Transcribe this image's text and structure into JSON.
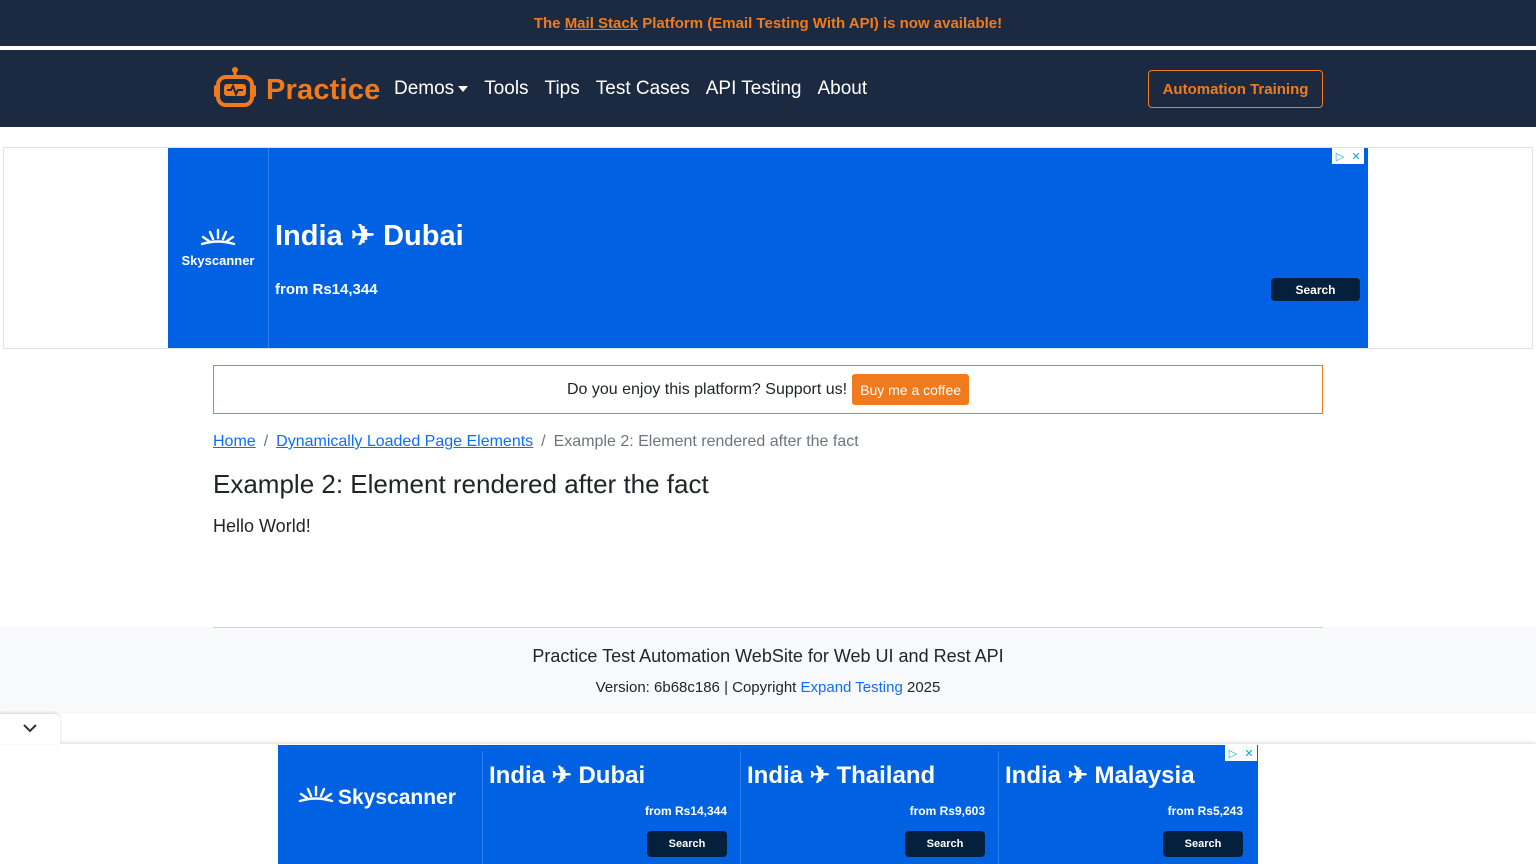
{
  "announcement": {
    "prefix": "The ",
    "link": "Mail Stack",
    "suffix": " Platform (Email Testing With API) is now available!"
  },
  "navbar": {
    "brand": "Practice",
    "links": [
      "Demos",
      "Tools",
      "Tips",
      "Test Cases",
      "API Testing",
      "About"
    ],
    "cta": "Automation Training"
  },
  "ad_top": {
    "logo": "Skyscanner",
    "route_from": "India",
    "route_to": "Dubai",
    "price": "from Rs14,344",
    "button": "Search"
  },
  "support": {
    "text": "Do you enjoy this platform? Support us!",
    "button": "Buy me a coffee"
  },
  "breadcrumb": {
    "home": "Home",
    "parent": "Dynamically Loaded Page Elements",
    "current": "Example 2: Element rendered after the fact"
  },
  "page": {
    "title": "Example 2: Element rendered after the fact",
    "content": "Hello World!"
  },
  "footer": {
    "title": "Practice Test Automation WebSite for Web UI and Rest API",
    "version_prefix": "Version: 6b68c186 | Copyright ",
    "company": "Expand Testing",
    "year": " 2025"
  },
  "ad_bottom": {
    "logo": "Skyscanner",
    "cards": [
      {
        "from": "India",
        "to": "Dubai",
        "price": "from Rs14,344",
        "button": "Search"
      },
      {
        "from": "India",
        "to": "Thailand",
        "price": "from Rs9,603",
        "button": "Search"
      },
      {
        "from": "India",
        "to": "Malaysia",
        "price": "from Rs5,243",
        "button": "Search"
      }
    ]
  },
  "colors": {
    "navy": "#1b2a41",
    "accent_orange": "#f07b1e",
    "link_blue": "#0d6efd",
    "ad_blue": "#0062e3",
    "ad_button": "#05203c"
  },
  "icons": [
    "robot-logo-icon",
    "caret-down-icon",
    "skyscanner-sun-icon",
    "plane-icon",
    "adchoices-icon",
    "close-icon",
    "chevron-down-icon"
  ]
}
